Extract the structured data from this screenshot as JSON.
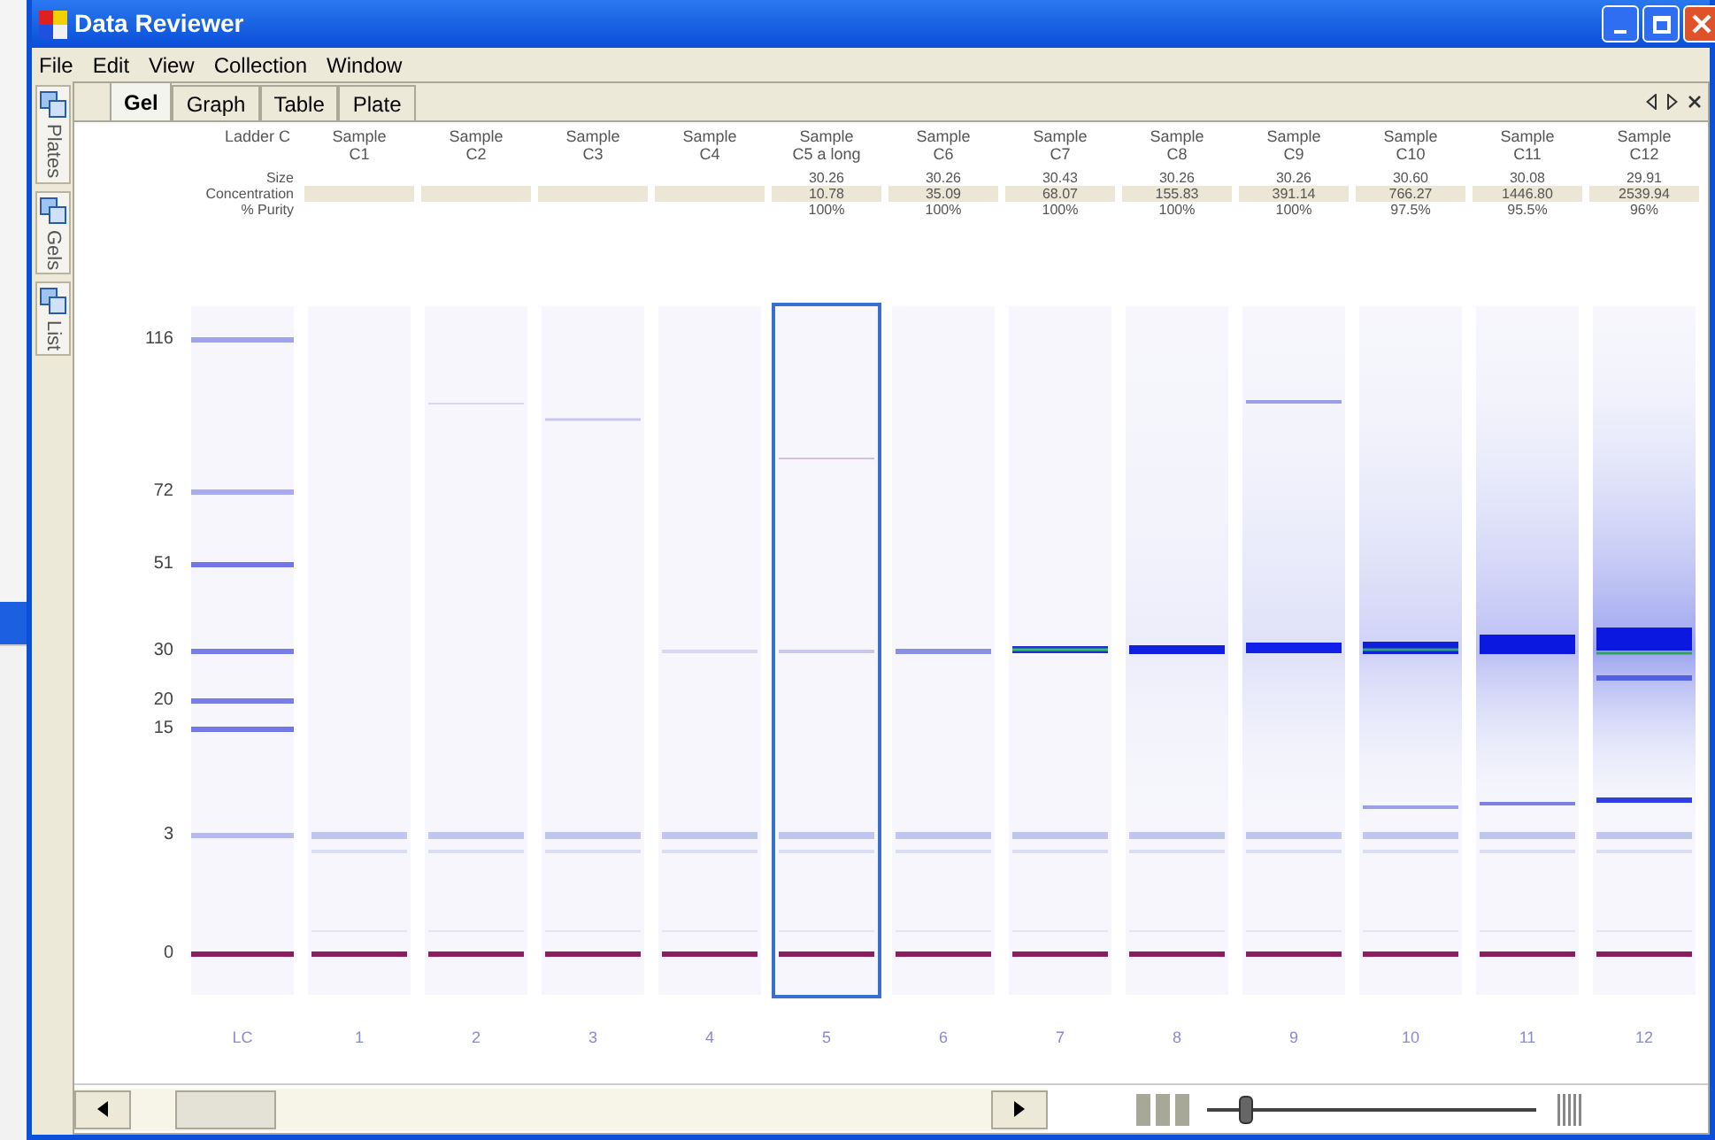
{
  "window": {
    "title": "Data Reviewer"
  },
  "menu": [
    "File",
    "Edit",
    "View",
    "Collection",
    "Window"
  ],
  "side_tabs": [
    {
      "label": "Plates",
      "selected": false
    },
    {
      "label": "Gels",
      "selected": false
    },
    {
      "label": "List",
      "selected": false
    }
  ],
  "tabs": [
    {
      "label": "Gel",
      "selected": true
    },
    {
      "label": "Graph",
      "selected": false
    },
    {
      "label": "Table",
      "selected": false
    },
    {
      "label": "Plate",
      "selected": false
    }
  ],
  "row_labels": [
    "Size",
    "Concentration",
    "% Purity"
  ],
  "y_axis": [
    "116",
    "72",
    "51",
    "30",
    "20",
    "15",
    "3",
    "0"
  ],
  "ladder": {
    "label": "Ladder C",
    "number": "LC"
  },
  "lanes": [
    {
      "label": [
        "Sample",
        "C1"
      ],
      "number": "1",
      "selected": false
    },
    {
      "label": [
        "Sample",
        "C2"
      ],
      "number": "2",
      "selected": false
    },
    {
      "label": [
        "Sample",
        "C3"
      ],
      "number": "3",
      "selected": false
    },
    {
      "label": [
        "Sample",
        "C4"
      ],
      "number": "4",
      "selected": false
    },
    {
      "label": [
        "Sample",
        "C5 a long"
      ],
      "size": "30.26",
      "concentration": "10.78",
      "purity": "100%",
      "number": "5",
      "selected": true
    },
    {
      "label": [
        "Sample",
        "C6"
      ],
      "size": "30.26",
      "concentration": "35.09",
      "purity": "100%",
      "number": "6",
      "selected": false
    },
    {
      "label": [
        "Sample",
        "C7"
      ],
      "size": "30.43",
      "concentration": "68.07",
      "purity": "100%",
      "number": "7",
      "selected": false
    },
    {
      "label": [
        "Sample",
        "C8"
      ],
      "size": "30.26",
      "concentration": "155.83",
      "purity": "100%",
      "number": "8",
      "selected": false
    },
    {
      "label": [
        "Sample",
        "C9"
      ],
      "size": "30.26",
      "concentration": "391.14",
      "purity": "100%",
      "number": "9",
      "selected": false
    },
    {
      "label": [
        "Sample",
        "C10"
      ],
      "size": "30.60",
      "concentration": "766.27",
      "purity": "97.5%",
      "number": "10",
      "selected": false
    },
    {
      "label": [
        "Sample",
        "C11"
      ],
      "size": "30.08",
      "concentration": "1446.80",
      "purity": "95.5%",
      "number": "11",
      "selected": false
    },
    {
      "label": [
        "Sample",
        "C12"
      ],
      "size": "29.91",
      "concentration": "2539.94",
      "purity": "96%",
      "number": "12",
      "selected": false
    }
  ],
  "zoom_slider": {
    "level": 0.1
  }
}
